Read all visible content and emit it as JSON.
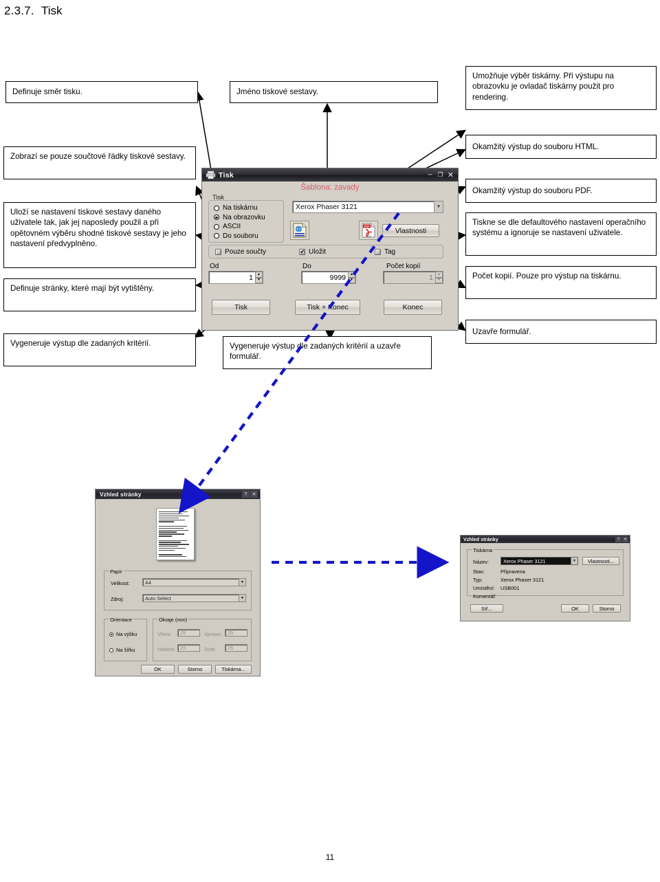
{
  "heading": {
    "number": "2.3.7.",
    "title": "Tisk"
  },
  "page_number": "11",
  "callouts": {
    "smer_tisku": "Definuje směr tisku.",
    "jmeno_sestavy": "Jméno tiskové sestavy.",
    "vyber_tiskarny": "Umožňuje výběr tiskárny. Při výstupu na obrazovku je ovladač tiskárny použit pro rendering.",
    "html": "Okamžitý výstup do souboru HTML.",
    "pdf": "Okamžitý výstup do souboru PDF.",
    "souctove_radky": "Zobrazí se pouze součtové řádky tiskové sestavy.",
    "ulozi_nastaveni": "Uloží se nastavení tiskové sestavy daného uživatele tak, jak jej naposledy použil a při opětovném výběru shodné tiskové sestavy je jeho nastavení předvyplněno.",
    "defaultove": "Tiskne se dle defaultového nastavení operačního systému a ignoruje se nastavení uživatele.",
    "stranky": "Definuje stránky, které mají být vytištěny.",
    "pocet_kopii": "Počet kopií. Pouze pro výstup  na tiskárnu.",
    "vystup": "Vygeneruje výstup dle zadaných kritérií.",
    "vystup_zavre": "Vygeneruje výstup dle zadaných kritérií a uzavře formulář.",
    "uzavre": "Uzavře formulář."
  },
  "tisk_dialog": {
    "title": "Tisk",
    "icon": "printer-icon",
    "titlebar_buttons": [
      "minimize",
      "maximize",
      "close"
    ],
    "template_label": "Šablona: zavady",
    "group_label": "Tisk",
    "radios": [
      {
        "label": "Na tiskárnu",
        "selected": false
      },
      {
        "label": "Na obrazovku",
        "selected": true
      },
      {
        "label": "ASCII",
        "selected": false
      },
      {
        "label": "Do souboru",
        "selected": false
      }
    ],
    "printer_combo_value": "Xerox Phaser 3121",
    "html_button_icon": "html-document-icon",
    "pdf_button_icon": "pdf-document-icon",
    "properties_button": "Vlastnosti",
    "checkboxes": [
      {
        "label": "Pouze součty",
        "checked": false
      },
      {
        "label": "Uložit",
        "checked": true
      },
      {
        "label": "Tag",
        "checked": false
      }
    ],
    "range": {
      "from_label": "Od",
      "from_value": "1",
      "to_label": "Do",
      "to_value": "9999",
      "copies_label": "Počet kopií",
      "copies_value": "1",
      "copies_disabled": true
    },
    "buttons": [
      {
        "label": "Tisk"
      },
      {
        "label": "Tisk + Konec"
      },
      {
        "label": "Konec"
      }
    ]
  },
  "page_setup_dialog": {
    "title": "Vzhled stránky",
    "titlebar_buttons": [
      "help",
      "close"
    ],
    "paper_group": "Papír",
    "size_label": "Velikost:",
    "size_value": "A4",
    "source_label": "Zdroj:",
    "source_value": "Auto Select",
    "orientation_group": "Orientace",
    "orientation_options": [
      {
        "label": "Na výšku",
        "selected": true
      },
      {
        "label": "Na šířku",
        "selected": false
      }
    ],
    "margins_group": "Okraje (mm)",
    "margins": [
      {
        "label": "Vlevo:",
        "value": "25"
      },
      {
        "label": "Vpravo:",
        "value": "25"
      },
      {
        "label": "Nahoře:",
        "value": "25"
      },
      {
        "label": "Dole:",
        "value": "25"
      }
    ],
    "buttons": [
      {
        "label": "OK"
      },
      {
        "label": "Storno"
      },
      {
        "label": "Tiskárna..."
      }
    ]
  },
  "printer_dialog": {
    "title": "Vzhled stránky",
    "titlebar_buttons": [
      "help",
      "close"
    ],
    "group_label": "Tiskárna",
    "name_label": "Název:",
    "name_value": "Xerox Phaser 3121",
    "properties_button": "Vlastnosti...",
    "status_label": "Stav:",
    "status_value": "Připravena",
    "type_label": "Typ:",
    "type_value": "Xerox Phaser 3121",
    "location_label": "Umístění:",
    "location_value": "USB001",
    "comment_label": "Komentář:",
    "comment_value": "",
    "buttons": [
      {
        "label": "Síť..."
      },
      {
        "label": "OK"
      },
      {
        "label": "Storno"
      }
    ]
  },
  "colors": {
    "callout_border": "#000000",
    "dialog_face": "#d4d0c8",
    "template_text": "#d9616a",
    "flow_arrow": "#1414c8"
  }
}
